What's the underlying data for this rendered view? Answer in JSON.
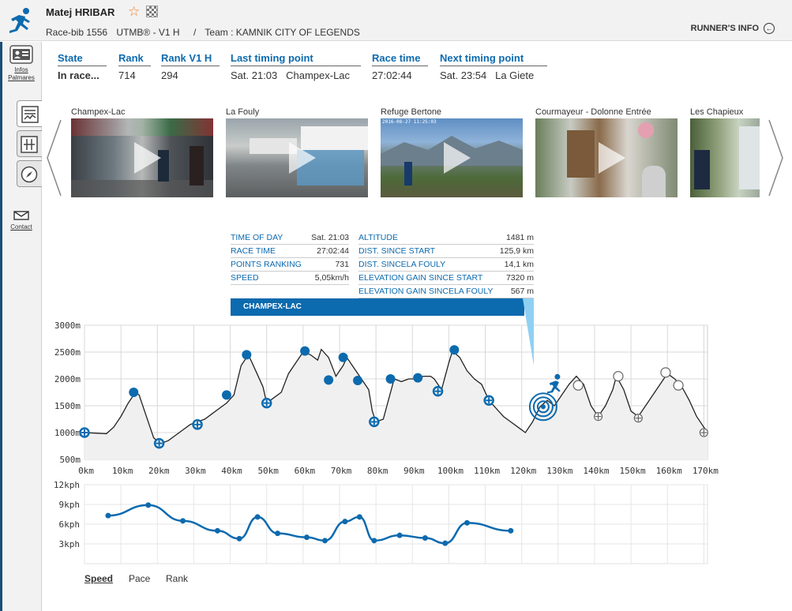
{
  "runner": {
    "name": "Matej HRIBAR",
    "bib": "Race-bib 1556",
    "category": "UTMB® - V1 H",
    "separator": "/",
    "team": "Team : KAMNIK CITY OF LEGENDS",
    "runner_info_label": "RUNNER'S INFO"
  },
  "sidebar": {
    "infos_label": "Infos",
    "palmares_label": "Palmares",
    "contact_label": "Contact"
  },
  "stats": [
    {
      "label": "State",
      "value": "In race..."
    },
    {
      "label": "Rank",
      "value": "714"
    },
    {
      "label": "Rank V1 H",
      "value": "294"
    },
    {
      "label": "Last timing point",
      "value": "Sat. 21:03   Champex-Lac"
    },
    {
      "label": "Race time",
      "value": "27:02:44"
    },
    {
      "label": "Next timing point",
      "value": "Sat. 23:54   La Giete"
    }
  ],
  "thumbnails": [
    {
      "caption": "Champex-Lac",
      "stamp": ""
    },
    {
      "caption": "La Fouly",
      "stamp": ""
    },
    {
      "caption": "Refuge Bertone",
      "stamp": "2016-08-27 11:25:03"
    },
    {
      "caption": "Courmayeur - Dolonne Entrée",
      "stamp": ""
    },
    {
      "caption": "Les Chapieux",
      "stamp": ""
    }
  ],
  "timing_info": {
    "left": [
      {
        "k": "TIME OF DAY",
        "v": "Sat. 21:03"
      },
      {
        "k": "RACE TIME",
        "v": "27:02:44"
      },
      {
        "k": "POINTS RANKING",
        "v": "731"
      },
      {
        "k": "SPEED",
        "v": "5,05km/h"
      }
    ],
    "right": [
      {
        "k": "ALTITUDE",
        "v": "1481 m"
      },
      {
        "k": "DIST. SINCE START",
        "v": "125,9 km"
      },
      {
        "k": "DIST. SINCELA FOULY",
        "v": "14,1 km"
      },
      {
        "k": "ELEVATION GAIN SINCE START",
        "v": "7320 m"
      },
      {
        "k": "ELEVATION GAIN SINCELA FOULY",
        "v": "567 m"
      }
    ],
    "checkpoint": "CHAMPEX-LAC"
  },
  "colors": {
    "accent": "#0c6aae",
    "star": "#f07b1e",
    "grid": "#d8d8d8",
    "profile_fill": "#f0f0f0"
  },
  "chart_data": [
    {
      "type": "area",
      "title": "",
      "x_unit": "km",
      "xlim": [
        0,
        171
      ],
      "ylim": [
        500,
        3000
      ],
      "x_ticks": [
        "0km",
        "10km",
        "20km",
        "30km",
        "40km",
        "50km",
        "60km",
        "70km",
        "80km",
        "90km",
        "100km",
        "110km",
        "120km",
        "130km",
        "140km",
        "150km",
        "160km",
        "170km"
      ],
      "y_ticks": [
        "500m",
        "1000m",
        "1500m",
        "2000m",
        "2500m",
        "3000m"
      ],
      "x_tick_values": [
        0,
        10,
        20,
        30,
        40,
        50,
        60,
        70,
        80,
        90,
        100,
        110,
        120,
        130,
        140,
        150,
        160,
        170
      ],
      "y_tick_values": [
        500,
        1000,
        1500,
        2000,
        2500,
        3000
      ],
      "grid": true,
      "profile": [
        [
          0,
          1000
        ],
        [
          3,
          990
        ],
        [
          6,
          980
        ],
        [
          8,
          1100
        ],
        [
          10,
          1300
        ],
        [
          12,
          1550
        ],
        [
          14,
          1750
        ],
        [
          15,
          1700
        ],
        [
          17,
          1300
        ],
        [
          19,
          900
        ],
        [
          21,
          800
        ],
        [
          23,
          850
        ],
        [
          25,
          950
        ],
        [
          27,
          1050
        ],
        [
          29,
          1150
        ],
        [
          31,
          1200
        ],
        [
          33,
          1250
        ],
        [
          35,
          1350
        ],
        [
          37,
          1450
        ],
        [
          39,
          1550
        ],
        [
          41,
          1700
        ],
        [
          43,
          2250
        ],
        [
          45,
          2450
        ],
        [
          47,
          2150
        ],
        [
          49,
          1850
        ],
        [
          50,
          1550
        ],
        [
          52,
          1650
        ],
        [
          54,
          1750
        ],
        [
          56,
          2100
        ],
        [
          58,
          2300
        ],
        [
          60,
          2500
        ],
        [
          62,
          2450
        ],
        [
          64,
          2350
        ],
        [
          65,
          2550
        ],
        [
          67,
          2400
        ],
        [
          69,
          2050
        ],
        [
          71,
          2250
        ],
        [
          72,
          2400
        ],
        [
          74,
          2200
        ],
        [
          76,
          2000
        ],
        [
          78,
          1800
        ],
        [
          79,
          1400
        ],
        [
          80,
          1200
        ],
        [
          82,
          1250
        ],
        [
          83,
          1500
        ],
        [
          85,
          2000
        ],
        [
          87,
          1950
        ],
        [
          89,
          2000
        ],
        [
          91,
          2000
        ],
        [
          93,
          2050
        ],
        [
          95,
          2050
        ],
        [
          96,
          2000
        ],
        [
          98,
          1800
        ],
        [
          100,
          2300
        ],
        [
          101,
          2520
        ],
        [
          103,
          2400
        ],
        [
          105,
          2150
        ],
        [
          107,
          2000
        ],
        [
          109,
          1900
        ],
        [
          111,
          1600
        ],
        [
          113,
          1450
        ],
        [
          115,
          1300
        ],
        [
          117,
          1200
        ],
        [
          119,
          1100
        ],
        [
          121,
          1000
        ],
        [
          123,
          1200
        ],
        [
          125,
          1481
        ],
        [
          127,
          1600
        ],
        [
          129,
          1500
        ],
        [
          131,
          1700
        ],
        [
          133,
          1900
        ],
        [
          135,
          2050
        ],
        [
          137,
          1900
        ],
        [
          139,
          1500
        ],
        [
          141,
          1300
        ],
        [
          143,
          1500
        ],
        [
          145,
          1800
        ],
        [
          146,
          2050
        ],
        [
          148,
          1800
        ],
        [
          150,
          1400
        ],
        [
          152,
          1300
        ],
        [
          154,
          1500
        ],
        [
          156,
          1700
        ],
        [
          158,
          1900
        ],
        [
          160,
          2100
        ],
        [
          162,
          2000
        ],
        [
          164,
          1850
        ],
        [
          166,
          1600
        ],
        [
          168,
          1300
        ],
        [
          170,
          1100
        ],
        [
          171,
          1000
        ]
      ],
      "passed_points": [
        {
          "x": 0,
          "y": 1000,
          "kind": "ring"
        },
        {
          "x": 13.5,
          "y": 1750,
          "kind": "dot"
        },
        {
          "x": 20.5,
          "y": 800,
          "kind": "ring"
        },
        {
          "x": 31,
          "y": 1150,
          "kind": "ring"
        },
        {
          "x": 39,
          "y": 1700,
          "kind": "dot"
        },
        {
          "x": 44.5,
          "y": 2450,
          "kind": "dot"
        },
        {
          "x": 50,
          "y": 1550,
          "kind": "ring"
        },
        {
          "x": 60.5,
          "y": 2520,
          "kind": "dot"
        },
        {
          "x": 67,
          "y": 1980,
          "kind": "dot"
        },
        {
          "x": 71,
          "y": 2400,
          "kind": "dot"
        },
        {
          "x": 75,
          "y": 1970,
          "kind": "dot"
        },
        {
          "x": 79.5,
          "y": 1200,
          "kind": "ring"
        },
        {
          "x": 84,
          "y": 2000,
          "kind": "dot"
        },
        {
          "x": 91.5,
          "y": 2020,
          "kind": "dot"
        },
        {
          "x": 97,
          "y": 1770,
          "kind": "ring"
        },
        {
          "x": 101.5,
          "y": 2540,
          "kind": "dot"
        },
        {
          "x": 111,
          "y": 1600,
          "kind": "ring"
        }
      ],
      "current_point": {
        "x": 125.9,
        "y": 1481
      },
      "future_points": [
        {
          "x": 135.5,
          "y": 1880,
          "kind": "circle"
        },
        {
          "x": 141,
          "y": 1300,
          "kind": "cross"
        },
        {
          "x": 146.5,
          "y": 2050,
          "kind": "circle"
        },
        {
          "x": 152,
          "y": 1270,
          "kind": "cross"
        },
        {
          "x": 159.5,
          "y": 2120,
          "kind": "circle"
        },
        {
          "x": 163,
          "y": 1880,
          "kind": "circle"
        },
        {
          "x": 170,
          "y": 1000,
          "kind": "cross"
        }
      ]
    },
    {
      "type": "line",
      "title": "",
      "ylim": [
        0,
        12
      ],
      "y_ticks": [
        "3kph",
        "6kph",
        "9kph",
        "12kph"
      ],
      "y_tick_values": [
        3,
        6,
        9,
        12
      ],
      "grid": true,
      "series": [
        {
          "values": [
            [
              6.5,
              7.3
            ],
            [
              17.5,
              8.9
            ],
            [
              27,
              6.5
            ],
            [
              36.5,
              5
            ],
            [
              42.5,
              3.8
            ],
            [
              47.5,
              7.1
            ],
            [
              53,
              4.6
            ],
            [
              61,
              4
            ],
            [
              66,
              3.5
            ],
            [
              71.5,
              6.4
            ],
            [
              75.5,
              7.1
            ],
            [
              79.5,
              3.5
            ],
            [
              86.5,
              4.3
            ],
            [
              93.5,
              3.9
            ],
            [
              99,
              3.1
            ],
            [
              105,
              6.2
            ],
            [
              117,
              5
            ]
          ]
        }
      ]
    }
  ],
  "tabs": [
    {
      "label": "Speed",
      "active": true
    },
    {
      "label": "Pace",
      "active": false
    },
    {
      "label": "Rank",
      "active": false
    }
  ]
}
